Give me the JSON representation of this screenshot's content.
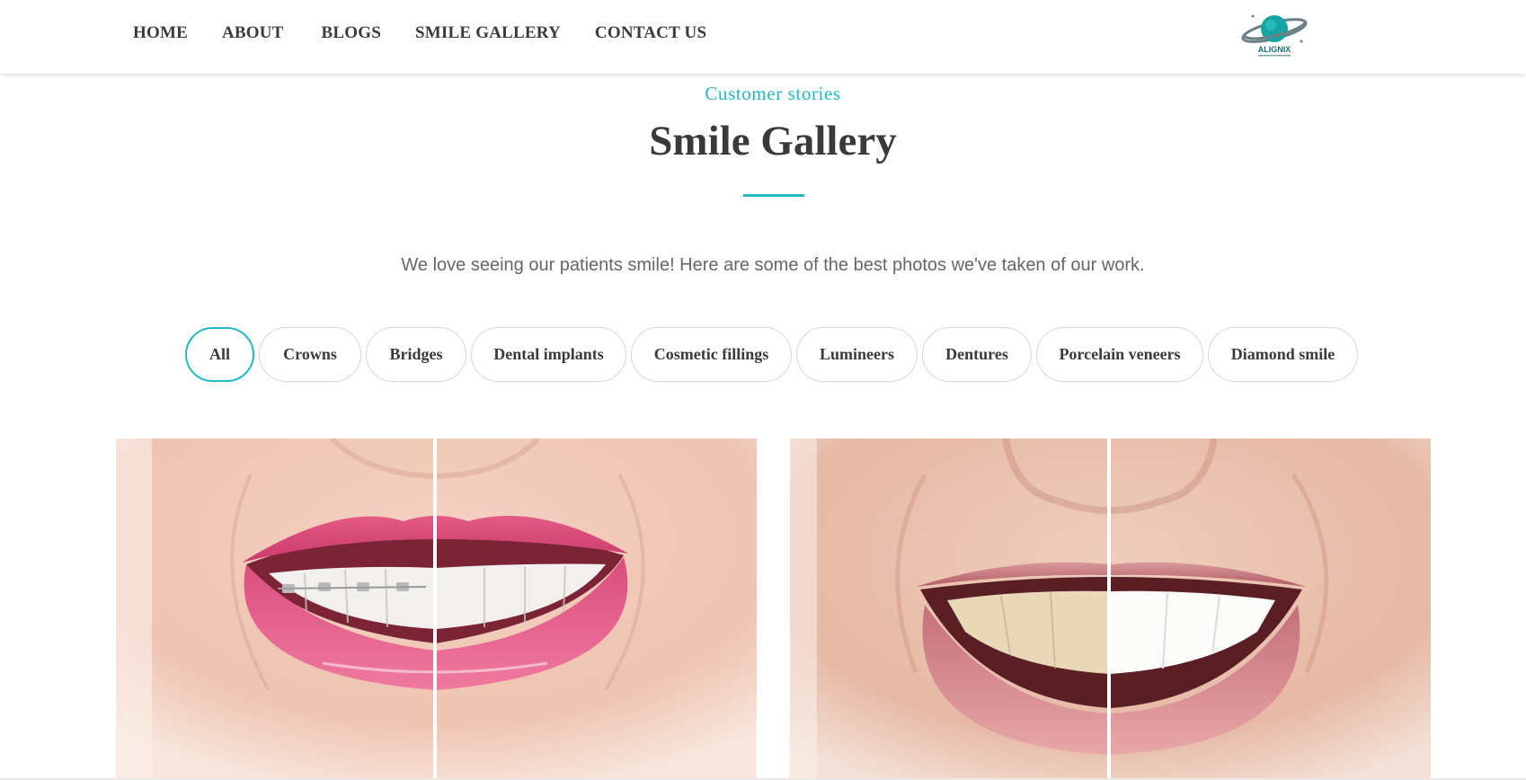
{
  "nav": {
    "items": [
      "HOME",
      "ABOUT",
      "BLOGS",
      "SMILE GALLERY",
      "CONTACT US"
    ]
  },
  "logo": {
    "text": "ALIGNIX"
  },
  "hero": {
    "eyebrow": "Customer stories",
    "title": "Smile Gallery",
    "lead": "We love seeing our patients smile! Here are some of the best photos we've taken of our work."
  },
  "filters": {
    "active": "All",
    "items": [
      "All",
      "Crowns",
      "Bridges",
      "Dental implants",
      "Cosmetic fillings",
      "Lumineers",
      "Dentures",
      "Porcelain veneers",
      "Diamond smile"
    ]
  },
  "gallery": [
    {
      "description_icon": "before-after-braces-image"
    },
    {
      "description_icon": "before-after-whitening-image"
    }
  ],
  "colors": {
    "accent": "#22b8c5",
    "text": "#3a3a3a",
    "muted": "#666666",
    "pill_border": "#d6d6d6"
  }
}
